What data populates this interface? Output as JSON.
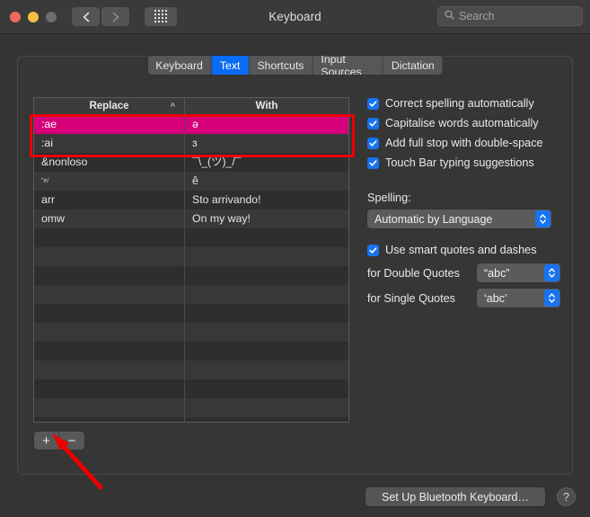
{
  "window": {
    "title": "Keyboard",
    "traffic_lights": [
      "close",
      "minimize",
      "zoom"
    ],
    "back_label": "Back",
    "forward_label": "Forward",
    "grid_label": "Show All Preferences"
  },
  "search": {
    "placeholder": "Search",
    "value": "",
    "icon": "search-icon"
  },
  "tabs": [
    {
      "label": "Keyboard",
      "active": false
    },
    {
      "label": "Text",
      "active": true
    },
    {
      "label": "Shortcuts",
      "active": false
    },
    {
      "label": "Input Sources",
      "active": false
    },
    {
      "label": "Dictation",
      "active": false
    }
  ],
  "table": {
    "columns": [
      "Replace",
      "With"
    ],
    "sort_column": "Replace",
    "sort_indicator": "^",
    "rows": [
      {
        "replace": ":ae",
        "with": "ə",
        "selected": true,
        "tiny": false
      },
      {
        "replace": ":ai",
        "with": "ɜ",
        "selected": false,
        "tiny": false
      },
      {
        "replace": "&nonloso",
        "with": "¯\\_(ツ)_/¯",
        "selected": false,
        "tiny": false
      },
      {
        "replace": "\"e/",
        "with": "ê",
        "selected": false,
        "tiny": true
      },
      {
        "replace": "arr",
        "with": "Sto arrivando!",
        "selected": false,
        "tiny": false
      },
      {
        "replace": "omw",
        "with": "On my way!",
        "selected": false,
        "tiny": false
      }
    ],
    "empty_row_count": 11,
    "selection_color": "#d6007b"
  },
  "list_controls": {
    "add_label": "+",
    "remove_label": "−"
  },
  "options": {
    "checkboxes": [
      {
        "label": "Correct spelling automatically",
        "checked": true
      },
      {
        "label": "Capitalise words automatically",
        "checked": true
      },
      {
        "label": "Add full stop with double-space",
        "checked": true
      },
      {
        "label": "Touch Bar typing suggestions",
        "checked": true
      }
    ],
    "spelling": {
      "label": "Spelling:",
      "value": "Automatic by Language"
    },
    "smart_quotes": {
      "label": "Use smart quotes and dashes",
      "checked": true
    },
    "double_quotes": {
      "label": "for Double Quotes",
      "value": "“abc”"
    },
    "single_quotes": {
      "label": "for Single Quotes",
      "value": "‘abc’"
    }
  },
  "footer": {
    "bluetooth_label": "Set Up Bluetooth Keyboard…",
    "help_label": "?"
  },
  "annotations": {
    "highlight_color": "#ee0000",
    "arrow_target": "add-row-button"
  }
}
